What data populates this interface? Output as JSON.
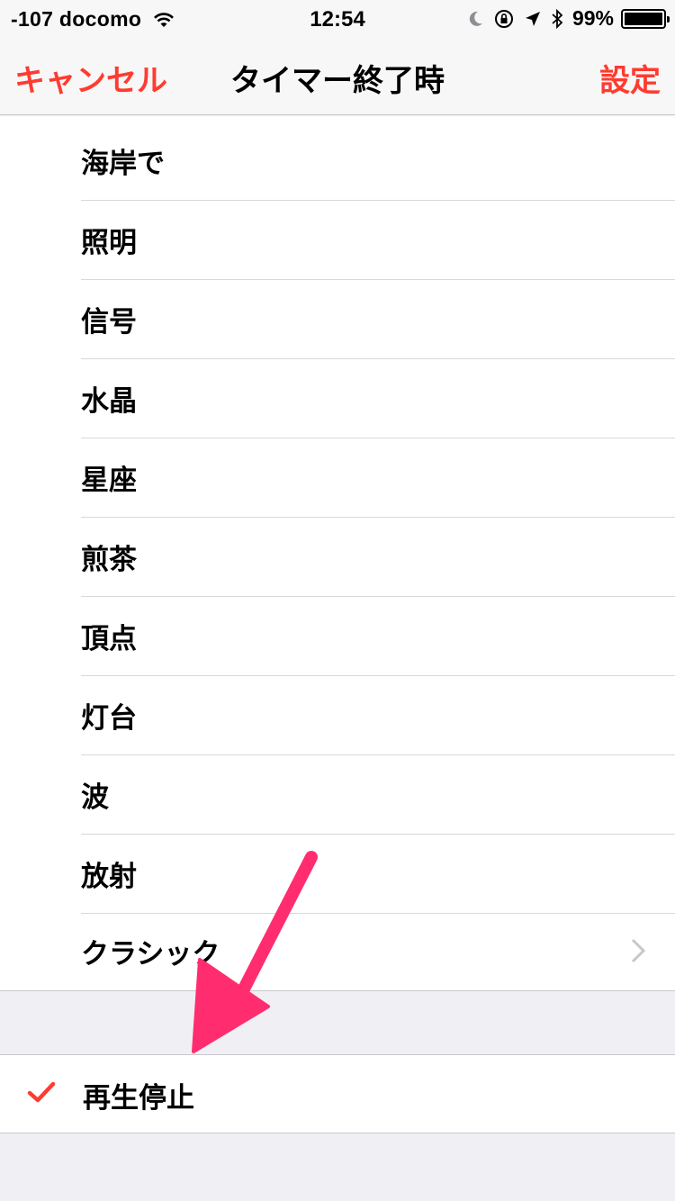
{
  "status_bar": {
    "carrier": "-107 docomo",
    "time": "12:54",
    "battery_percent": "99%",
    "battery_level": 0.99,
    "icons": [
      "wifi-icon",
      "moon-icon",
      "rotation-lock-icon",
      "location-arrow-icon",
      "bluetooth-icon",
      "battery-icon"
    ]
  },
  "nav": {
    "cancel_label": "キャンセル",
    "title": "タイマー終了時",
    "set_label": "設定"
  },
  "sounds": [
    {
      "label": "海岸で"
    },
    {
      "label": "照明"
    },
    {
      "label": "信号"
    },
    {
      "label": "水晶"
    },
    {
      "label": "星座"
    },
    {
      "label": "煎茶"
    },
    {
      "label": "頂点"
    },
    {
      "label": "灯台"
    },
    {
      "label": "波"
    },
    {
      "label": "放射"
    },
    {
      "label": "クラシック"
    }
  ],
  "stop_option": {
    "label": "再生停止",
    "selected": true
  },
  "colors": {
    "accent": "#ff3b30",
    "annotation": "#ff2d6f",
    "background": "#efeff4"
  }
}
